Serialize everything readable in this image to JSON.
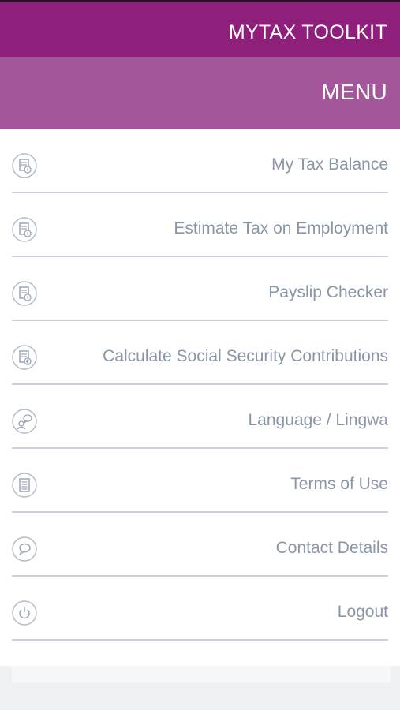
{
  "header": {
    "title": "MYTAX TOOLKIT"
  },
  "menu": {
    "label": "MENU"
  },
  "items": [
    {
      "label": "My Tax Balance",
      "icon": "document-info-icon"
    },
    {
      "label": "Estimate Tax on Employment",
      "icon": "document-info-icon"
    },
    {
      "label": "Payslip Checker",
      "icon": "document-info-icon"
    },
    {
      "label": "Calculate Social Security Contributions",
      "icon": "document-euro-icon"
    },
    {
      "label": "Language / Lingwa",
      "icon": "language-icon"
    },
    {
      "label": "Terms of Use",
      "icon": "document-lines-icon"
    },
    {
      "label": "Contact Details",
      "icon": "speech-bubble-icon"
    },
    {
      "label": "Logout",
      "icon": "power-icon"
    }
  ],
  "colors": {
    "topbar": "#8e1f7a",
    "menubar": "#a4569a",
    "item_text": "#8a96a8"
  }
}
